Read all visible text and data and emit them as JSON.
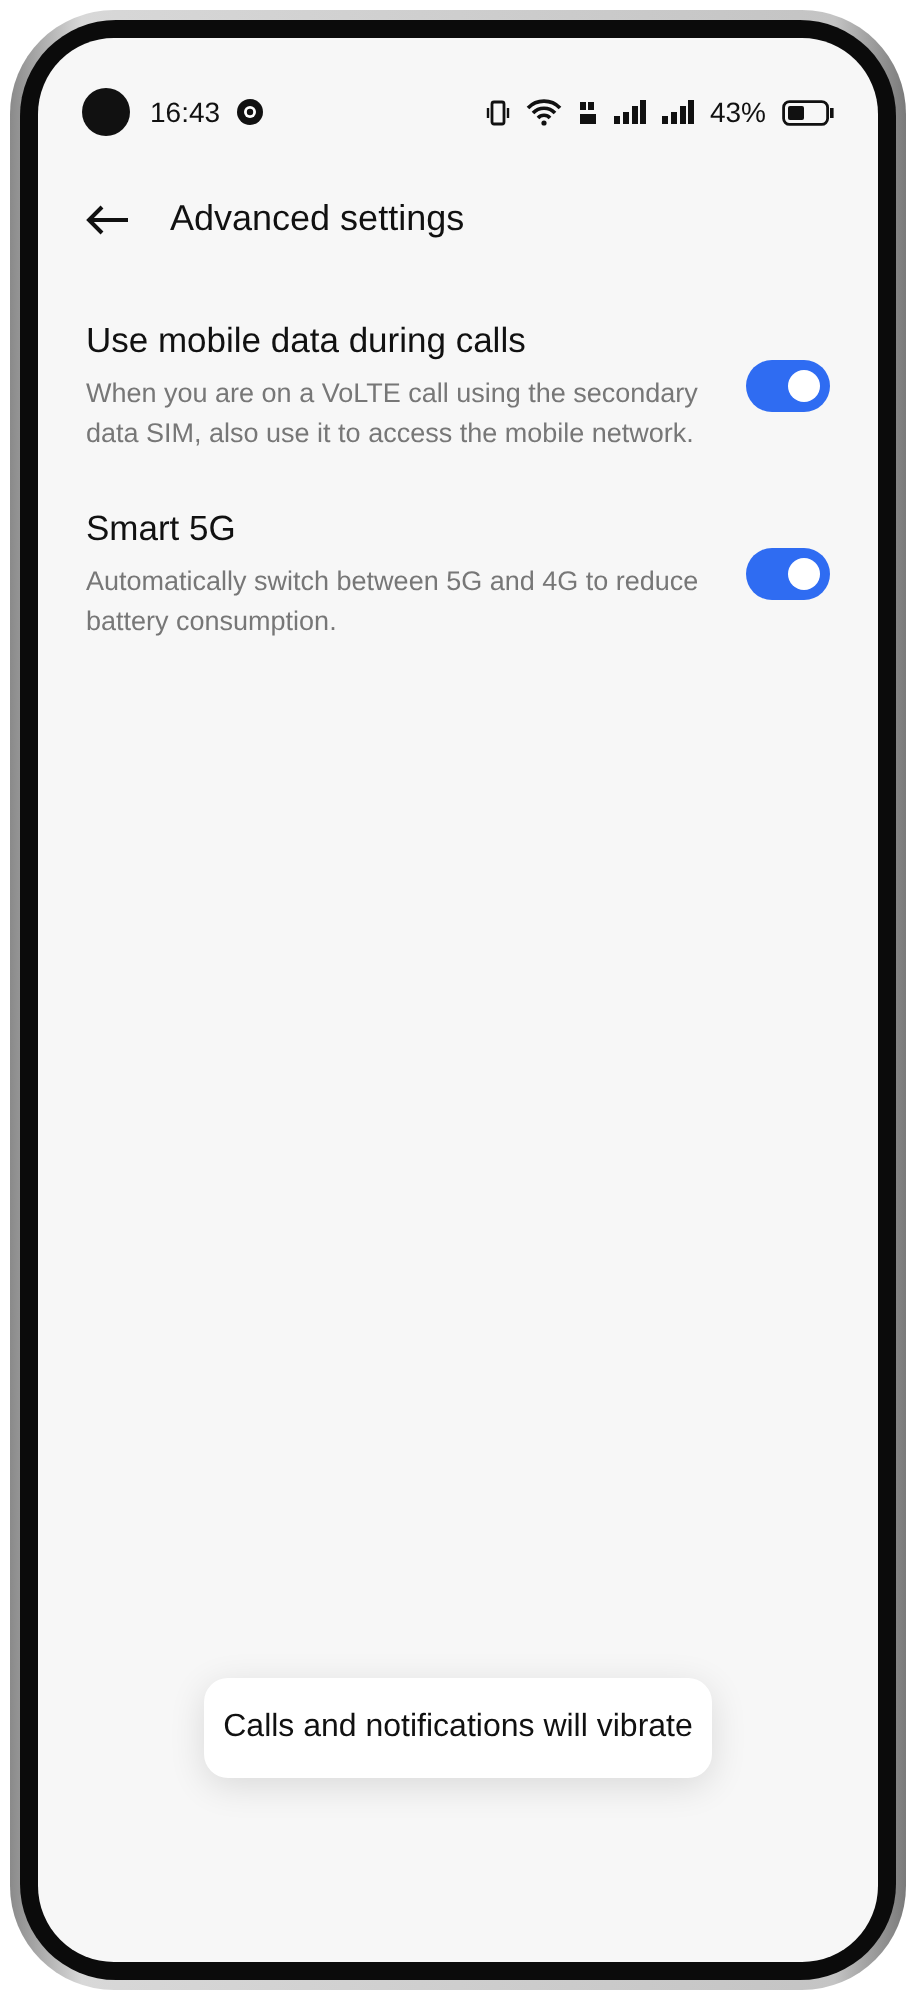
{
  "status_bar": {
    "time": "16:43",
    "battery": "43%"
  },
  "header": {
    "title": "Advanced settings"
  },
  "settings": [
    {
      "title": "Use mobile data during calls",
      "description": "When you are on a VoLTE call using the secondary data SIM, also use it to access the mobile network.",
      "on": true
    },
    {
      "title": "Smart 5G",
      "description": "Automatically switch between 5G and 4G to reduce battery consumption.",
      "on": true
    }
  ],
  "toast": "Calls and notifications will vibrate"
}
